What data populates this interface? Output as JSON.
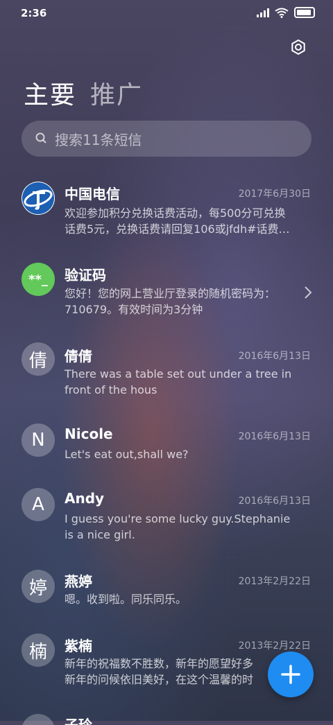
{
  "status": {
    "time": "2:36"
  },
  "tabs": [
    {
      "label": "主要",
      "active": true
    },
    {
      "label": "推广",
      "active": false
    }
  ],
  "search": {
    "placeholder": "搜索11条短信"
  },
  "messages": [
    {
      "name": "中国电信",
      "date": "2017年6月30日",
      "preview": "欢迎参加积分兑换话费活动，每500分可兑换\n话费5元，兑换话费请回复106或jfdh#话费…",
      "avatar": ""
    },
    {
      "name": "验证码",
      "date": "",
      "preview": "您好！您的网上营业厅登录的随机密码为：\n710679。有效时间为3分钟",
      "avatar": "**_"
    },
    {
      "name": "倩倩",
      "date": "2016年6月13日",
      "preview": "There was a table set out under a tree in\nfront of the hous",
      "avatar": "倩"
    },
    {
      "name": "Nicole",
      "date": "2016年6月13日",
      "preview": "Let's eat out,shall we?",
      "avatar": "N"
    },
    {
      "name": "Andy",
      "date": "2016年6月13日",
      "preview": "I guess you're some lucky guy.Stephanie\nis a nice girl.",
      "avatar": "A"
    },
    {
      "name": "燕婷",
      "date": "2013年2月22日",
      "preview": "嗯。收到啦。同乐同乐。",
      "avatar": "婷"
    },
    {
      "name": "紫楠",
      "date": "2013年2月22日",
      "preview": "新年的祝福数不胜数，新年的愿望好多\n新年的问候依旧美好，在这个温馨的时",
      "avatar": "楠"
    },
    {
      "name": "子玲",
      "date": "",
      "preview": "",
      "avatar": ""
    }
  ],
  "colors": {
    "accent": "#1e8cf0",
    "verify_avatar": "#62c95a",
    "telecom_blue": "#1c5fb3"
  }
}
